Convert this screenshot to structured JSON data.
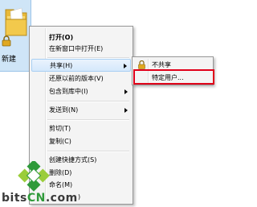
{
  "desktop": {
    "folder_label": "新建"
  },
  "context_menu": {
    "items": [
      {
        "label": "打开(O)"
      },
      {
        "label": "在新窗口中打开(E)"
      },
      {
        "label": "共享(H)"
      },
      {
        "label": "还原以前的版本(V)"
      },
      {
        "label": "包含到库中(I)"
      },
      {
        "label": "发送到(N)"
      },
      {
        "label": "剪切(T)"
      },
      {
        "label": "复制(C)"
      },
      {
        "label": "创建快捷方式(S)"
      },
      {
        "label": "删除(D)"
      },
      {
        "label": "命名(M)"
      },
      {
        "label": ")"
      }
    ]
  },
  "share_submenu": {
    "items": [
      {
        "label": "不共享",
        "icon": "lock-icon"
      },
      {
        "label": "特定用户..."
      }
    ]
  },
  "watermark": {
    "text_prefix": "bits",
    "text_cn": "CN",
    "text_suffix": ".com"
  }
}
